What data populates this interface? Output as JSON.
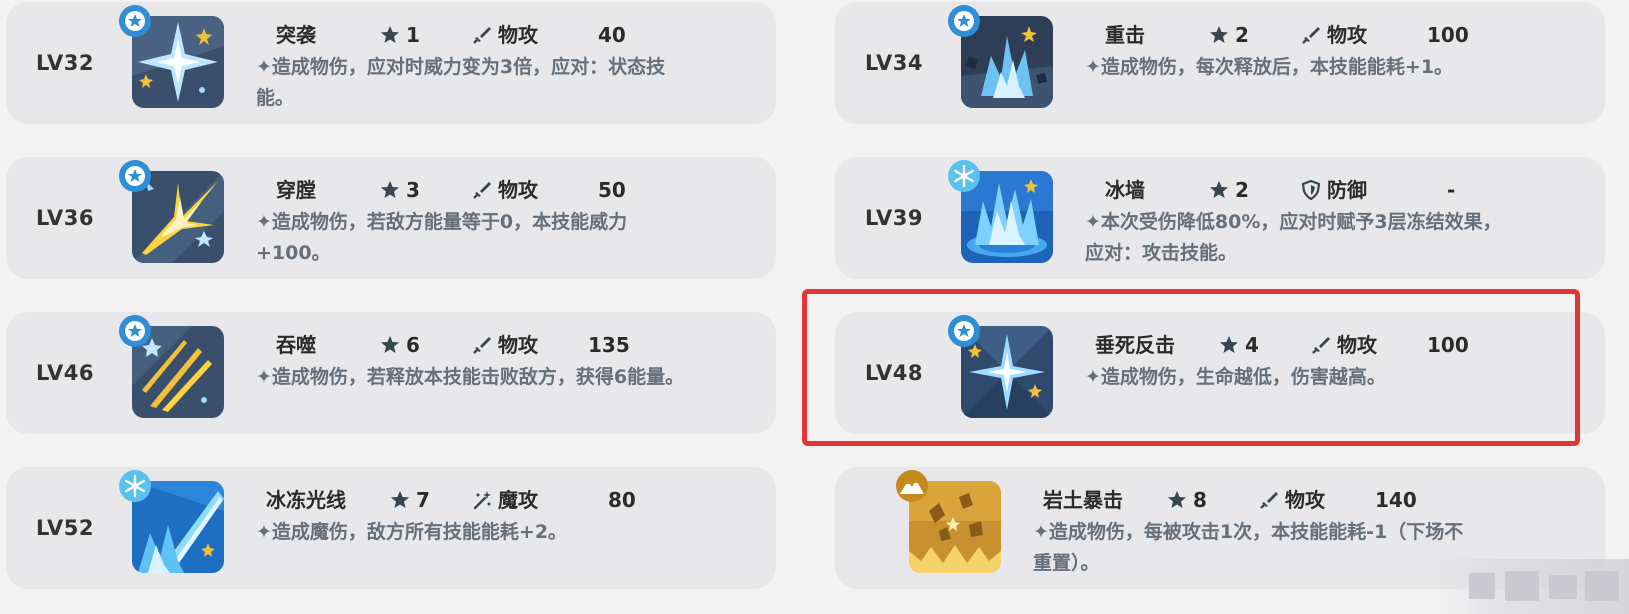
{
  "cards": [
    {
      "level": "LV32",
      "name": "突袭",
      "cost": "1",
      "type": "物攻",
      "power": "40",
      "desc1": "✦造成物伤，应对时威力变为3倍，应对：状态技",
      "desc2": "能。",
      "badge": "blue-star",
      "art": "burst"
    },
    {
      "level": "LV34",
      "name": "重击",
      "cost": "2",
      "type": "物攻",
      "power": "100",
      "desc1": "✦造成物伤，每次释放后，本技能能耗+1。",
      "desc2": "",
      "badge": "blue-star",
      "art": "impact"
    },
    {
      "level": "LV36",
      "name": "穿膛",
      "cost": "3",
      "type": "物攻",
      "power": "50",
      "desc1": "✦造成物伤，若敌方能量等于0，本技能威力",
      "desc2": "+100。",
      "badge": "blue-star",
      "art": "yellow-burst"
    },
    {
      "level": "LV39",
      "name": "冰墙",
      "cost": "2",
      "type": "防御",
      "power": "-",
      "desc1": "✦本次受伤降低80%，应对时赋予3层冻结效果，",
      "desc2": "应对：攻击技能。",
      "badge": "snowflake",
      "art": "ice-wall"
    },
    {
      "level": "LV46",
      "name": "吞噬",
      "cost": "6",
      "type": "物攻",
      "power": "135",
      "desc1": "✦造成物伤，若释放本技能击败敌方，获得6能量。",
      "desc2": "",
      "badge": "blue-star",
      "art": "slash"
    },
    {
      "level": "LV48",
      "name": "垂死反击",
      "cost": "4",
      "type": "物攻",
      "power": "100",
      "desc1": "✦造成物伤，生命越低，伤害越高。",
      "desc2": "",
      "badge": "blue-star",
      "art": "sparkle"
    },
    {
      "level": "LV52",
      "name": "冰冻光线",
      "cost": "7",
      "type": "魔攻",
      "power": "80",
      "desc1": "✦造成魔伤，敌方所有技能能耗+2。",
      "desc2": "",
      "badge": "snowflake",
      "art": "ice-beam"
    },
    {
      "level": "",
      "name": "岩土暴击",
      "cost": "8",
      "type": "物攻",
      "power": "140",
      "desc1": "✦造成物伤，每被攻击1次，本技能能耗-1（下场不",
      "desc2": "重置）。",
      "badge": "mountain",
      "art": "rock"
    }
  ],
  "colors": {
    "accent": "#e63333",
    "card": "#e8e8ea",
    "badge_blue": "#2e8fd6",
    "badge_gold": "#c58a1b"
  }
}
